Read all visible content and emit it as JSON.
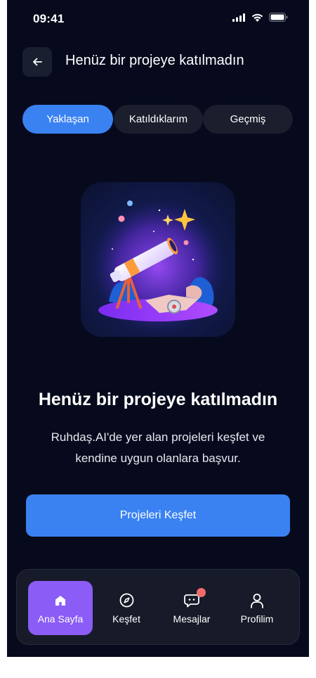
{
  "status_bar": {
    "time": "09:41"
  },
  "header": {
    "title": "Henüz bir projeye katılmadın"
  },
  "tabs": [
    {
      "label": "Yaklaşan",
      "active": true
    },
    {
      "label": "Katıldıklarım",
      "active": false
    },
    {
      "label": "Geçmiş",
      "active": false
    }
  ],
  "empty_state": {
    "illustration": "telescope-illustration",
    "title": "Henüz bir projeye katılmadın",
    "description": "Ruhdaş.AI'de yer alan projeleri keşfet ve kendine uygun olanlara başvur.",
    "cta_label": "Projeleri Keşfet"
  },
  "bottom_nav": [
    {
      "label": "Ana Sayfa",
      "icon": "home-icon",
      "active": true
    },
    {
      "label": "Keşfet",
      "icon": "compass-icon",
      "active": false
    },
    {
      "label": "Mesajlar",
      "icon": "chat-icon",
      "active": false,
      "badge": true
    },
    {
      "label": "Profilim",
      "icon": "user-icon",
      "active": false
    }
  ],
  "colors": {
    "background": "#060a1c",
    "accent_blue": "#3a82f2",
    "accent_purple": "#8b5cf6",
    "badge_red": "#f26b6b"
  }
}
